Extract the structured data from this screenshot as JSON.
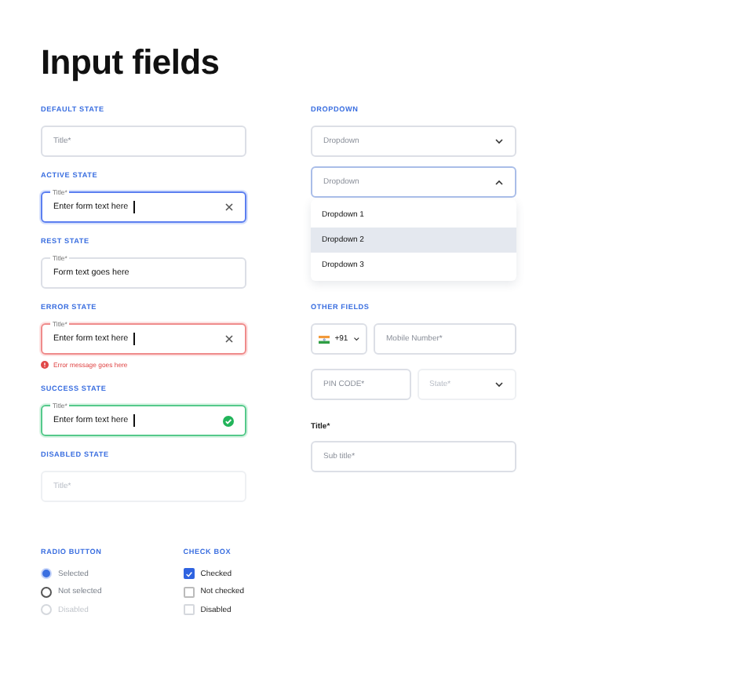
{
  "title": "Input fields",
  "states": [
    {
      "label": "DEFAULT STATE",
      "kind": "default",
      "placeholder": "Title*"
    },
    {
      "label": "ACTIVE STATE",
      "kind": "active",
      "float_label": "Title*",
      "value": "Enter form text here"
    },
    {
      "label": "REST STATE",
      "kind": "rest",
      "float_label": "Title*",
      "value": "Form text goes here"
    },
    {
      "label": "ERROR STATE",
      "kind": "error",
      "float_label": "Title*",
      "value": "Enter form text here",
      "error": "Error message goes here"
    },
    {
      "label": "SUCCESS STATE",
      "kind": "success",
      "float_label": "Title*",
      "value": "Enter form text here"
    },
    {
      "label": "DISABLED STATE",
      "kind": "disabled",
      "placeholder": "Title*"
    }
  ],
  "radio": {
    "label": "RADIO BUTTON",
    "items": [
      {
        "text": "Selected",
        "selected": true,
        "disabled": false
      },
      {
        "text": "Not selected",
        "selected": false,
        "disabled": false
      },
      {
        "text": "Disabled",
        "selected": false,
        "disabled": true
      }
    ]
  },
  "checkbox": {
    "label": "CHECK BOX",
    "items": [
      {
        "text": "Checked",
        "checked": true,
        "disabled": false
      },
      {
        "text": "Not checked",
        "checked": false,
        "disabled": false
      },
      {
        "text": "Disabled",
        "checked": false,
        "disabled": true
      }
    ]
  },
  "dropdown": {
    "label": "DROPDOWN",
    "closed": {
      "placeholder": "Dropdown",
      "expanded": false
    },
    "open": {
      "placeholder": "Dropdown",
      "expanded": true
    },
    "options": [
      {
        "text": "Dropdown 1",
        "selected": false
      },
      {
        "text": "Dropdown 2",
        "selected": true
      },
      {
        "text": "Dropdown 3",
        "selected": false
      }
    ]
  },
  "other": {
    "label": "OTHER FIELDS",
    "code": "+91",
    "mobile": "Mobile Number*",
    "pin": "PIN CODE*",
    "state": {
      "placeholder": "State*",
      "disabled": true
    },
    "title": "Title*",
    "subtitle": "Sub title*"
  }
}
